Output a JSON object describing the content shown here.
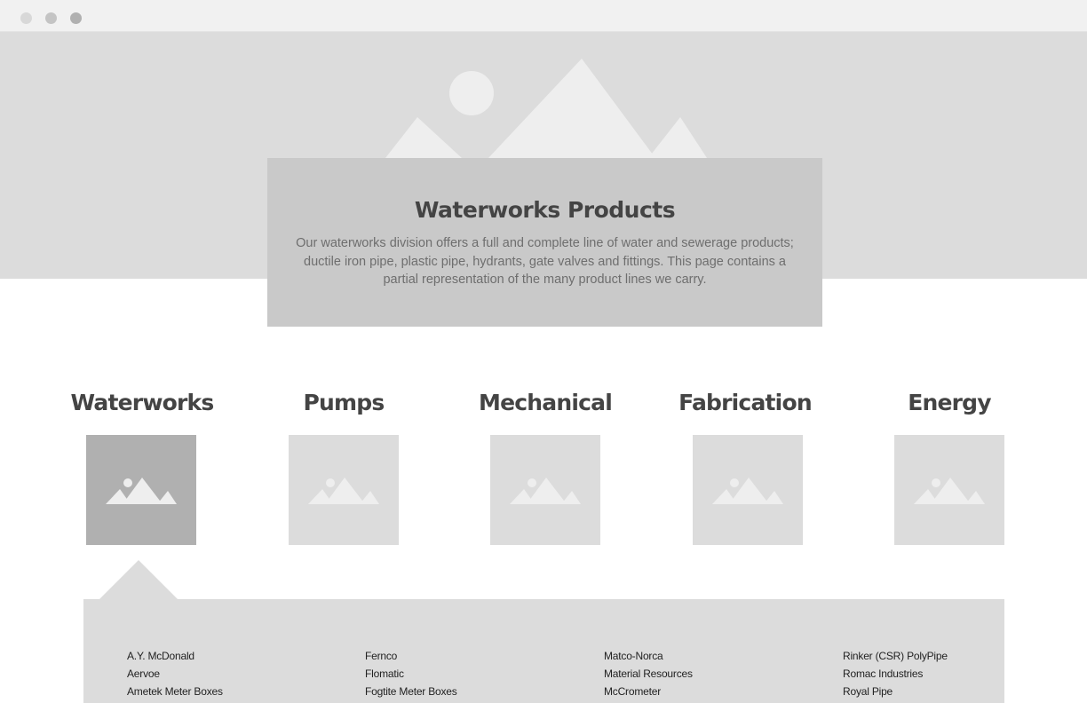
{
  "window": {
    "dot_colors": [
      "#d8d8d8",
      "#c4c4c4",
      "#b0b0b0"
    ]
  },
  "hero": {
    "image_icon": "image-placeholder-icon",
    "title": "Waterworks Products",
    "description": "Our waterworks division offers a full and complete line of water and sewerage products; ductile iron pipe, plastic pipe, hydrants, gate valves and fittings. This page contains a partial representation of the many product lines we carry."
  },
  "categories": [
    {
      "label": "Waterworks",
      "icon": "image-placeholder-icon",
      "selected": true
    },
    {
      "label": "Pumps",
      "icon": "image-placeholder-icon",
      "selected": false
    },
    {
      "label": "Mechanical",
      "icon": "image-placeholder-icon",
      "selected": false
    },
    {
      "label": "Fabrication",
      "icon": "image-placeholder-icon",
      "selected": false
    },
    {
      "label": "Energy",
      "icon": "image-placeholder-icon",
      "selected": false
    }
  ],
  "product_lines": {
    "columns": [
      [
        "A.Y. McDonald",
        "Aervoe",
        "Ametek Meter Boxes"
      ],
      [
        "Fernco",
        "Flomatic",
        "Fogtite Meter Boxes"
      ],
      [
        "Matco-Norca",
        "Material Resources",
        "McCrometer"
      ],
      [
        "Rinker (CSR) PolyPipe",
        "Romac Industries",
        "Royal Pipe"
      ]
    ]
  },
  "colors": {
    "background": "#ffffff",
    "hero_bg": "#dcdcdc",
    "card_bg": "#c9c9c9",
    "selected_thumb": "#b0b0b0",
    "heading": "#444444",
    "body_text": "#6e6e6e"
  }
}
